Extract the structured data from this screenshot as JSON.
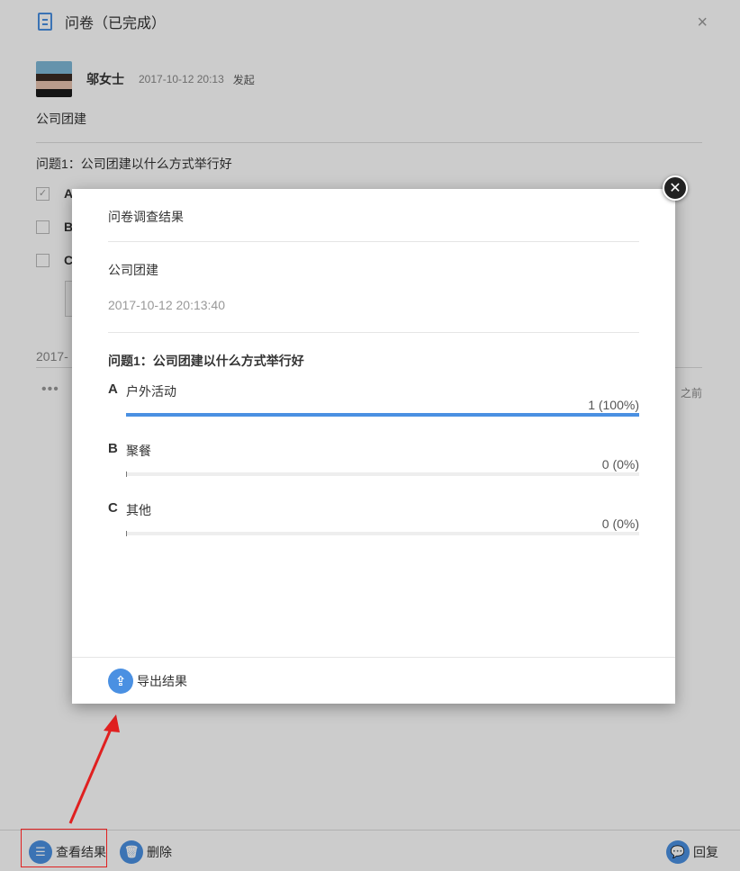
{
  "header": {
    "title": "问卷（已完成）"
  },
  "author": {
    "name": "邬女士",
    "time": "2017-10-12 20:13",
    "action": "发起"
  },
  "survey": {
    "title": "公司团建",
    "question": "问题1：公司团建以什么方式举行好",
    "options": [
      "A",
      "B",
      "C"
    ],
    "date_prefix": "2017-",
    "ago_text": "之前"
  },
  "footer": {
    "view_results": "查看结果",
    "delete": "删除",
    "reply": "回复"
  },
  "modal": {
    "heading": "问卷调查结果",
    "survey_title": "公司团建",
    "timestamp": "2017-10-12 20:13:40",
    "question": "问题1：公司团建以什么方式举行好",
    "results": [
      {
        "letter": "A",
        "label": "户外活动",
        "count_text": "1 (100%)",
        "percent": 100
      },
      {
        "letter": "B",
        "label": "聚餐",
        "count_text": "0 (0%)",
        "percent": 0
      },
      {
        "letter": "C",
        "label": "其他",
        "count_text": "0 (0%)",
        "percent": 0
      }
    ],
    "export_label": "导出结果"
  },
  "colors": {
    "accent": "#4a90e2",
    "highlight": "#e02020"
  }
}
